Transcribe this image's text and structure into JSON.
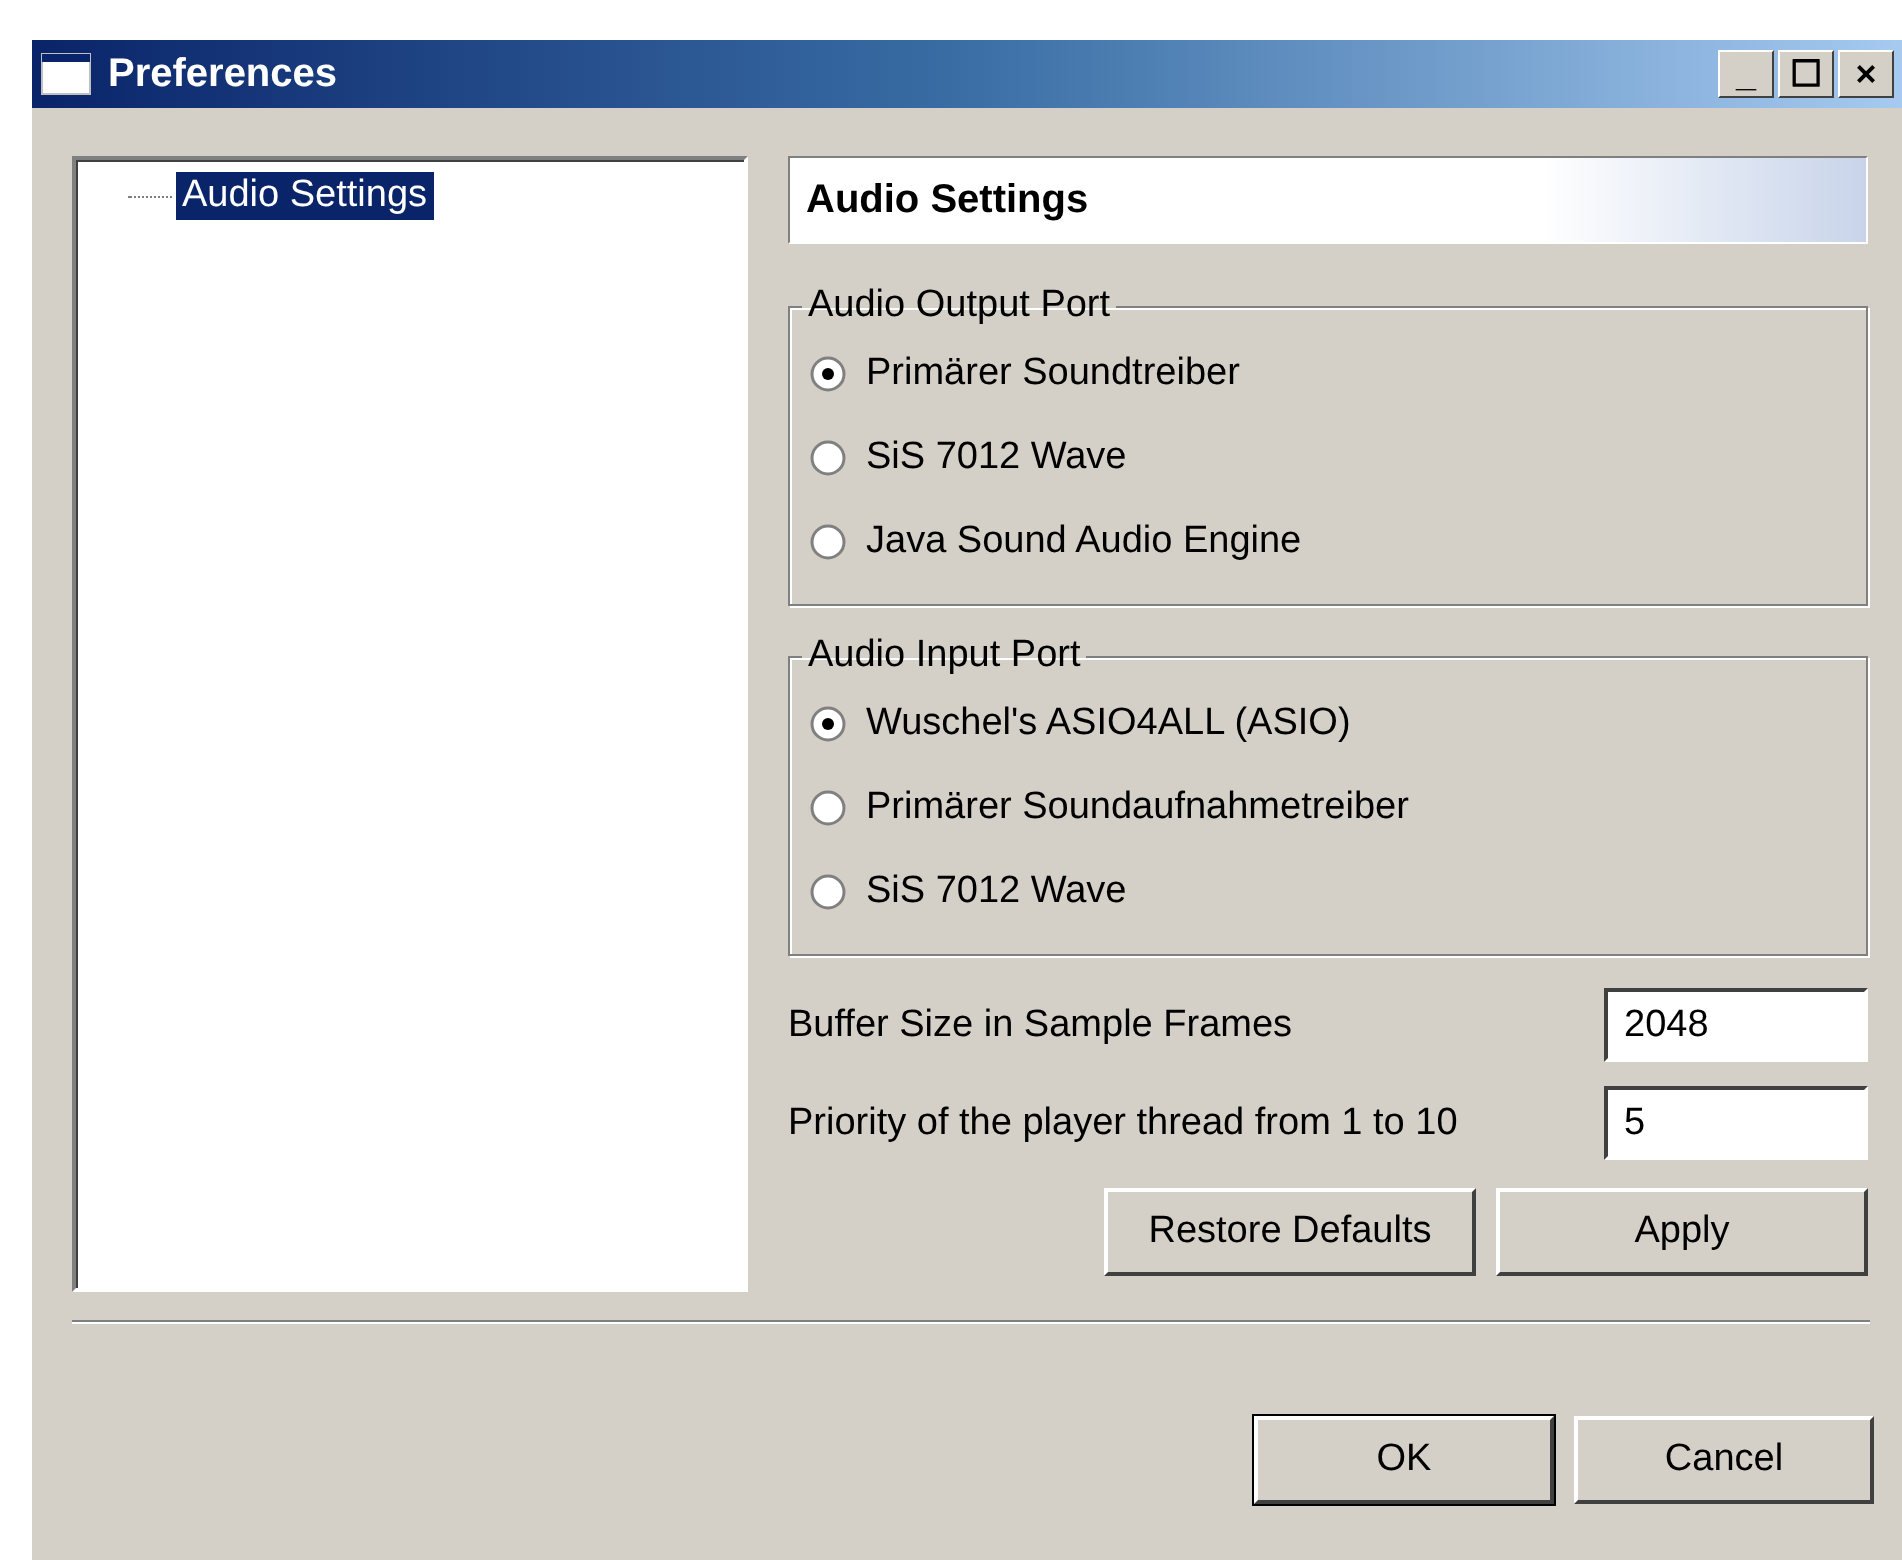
{
  "window": {
    "title": "Preferences",
    "controls": [
      "_",
      "☐",
      "×"
    ]
  },
  "tree": {
    "items": [
      {
        "label": "Audio Settings",
        "selected": true
      }
    ]
  },
  "panel": {
    "header": "Audio Settings",
    "groups": [
      {
        "title": "Audio Output Port",
        "options": [
          {
            "label": "Primärer Soundtreiber",
            "selected": true
          },
          {
            "label": "SiS 7012 Wave",
            "selected": false
          },
          {
            "label": "Java Sound Audio Engine",
            "selected": false
          }
        ]
      },
      {
        "title": "Audio Input Port",
        "options": [
          {
            "label": "Wuschel's ASIO4ALL (ASIO)",
            "selected": true
          },
          {
            "label": "Primärer Soundaufnahmetreiber",
            "selected": false
          },
          {
            "label": "SiS 7012 Wave",
            "selected": false
          }
        ]
      }
    ],
    "fields": [
      {
        "label": "Buffer Size in Sample Frames",
        "value": "2048"
      },
      {
        "label": "Priority of the player thread from 1 to 10",
        "value": "5"
      }
    ],
    "buttons": [
      "Restore Defaults",
      "Apply"
    ]
  },
  "buttons": [
    {
      "label": "OK",
      "default": true
    },
    {
      "label": "Cancel",
      "default": false
    }
  ]
}
